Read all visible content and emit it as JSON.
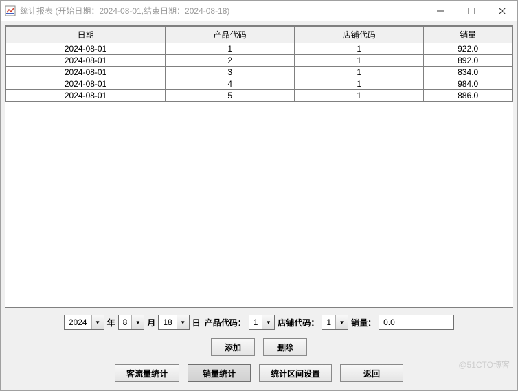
{
  "window": {
    "title": "统计报表 (开始日期：2024-08-01,结束日期：2024-08-18)"
  },
  "table": {
    "headers": [
      "日期",
      "产品代码",
      "店铺代码",
      "销量"
    ],
    "rows": [
      [
        "2024-08-01",
        "1",
        "1",
        "922.0"
      ],
      [
        "2024-08-01",
        "2",
        "1",
        "892.0"
      ],
      [
        "2024-08-01",
        "3",
        "1",
        "834.0"
      ],
      [
        "2024-08-01",
        "4",
        "1",
        "984.0"
      ],
      [
        "2024-08-01",
        "5",
        "1",
        "886.0"
      ]
    ]
  },
  "form": {
    "year_value": "2024",
    "year_label": "年",
    "month_value": "8",
    "month_label": "月",
    "day_value": "18",
    "day_label": "日",
    "product_code_label": "产品代码：",
    "product_code_value": "1",
    "store_code_label": "店铺代码：",
    "store_code_value": "1",
    "sales_label": "销量：",
    "sales_value": "0.0"
  },
  "buttons": {
    "add": "添加",
    "delete": "删除",
    "customer_stats": "客流量统计",
    "sales_stats": "销量统计",
    "interval_settings": "统计区间设置",
    "back": "返回"
  },
  "watermark": "@51CTO博客"
}
